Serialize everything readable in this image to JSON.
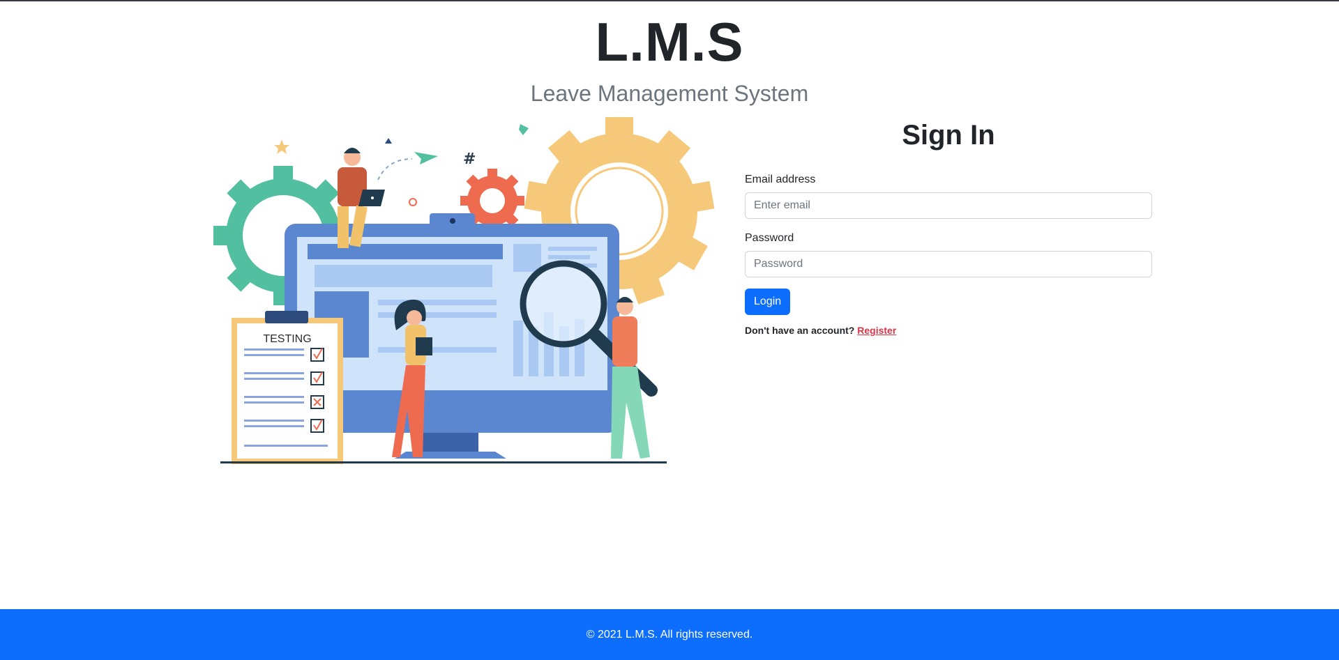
{
  "header": {
    "title": "L.M.S",
    "subtitle": "Leave Management System"
  },
  "illustration": {
    "clipboard_label": "TESTING",
    "description_icon": "testing-illustration"
  },
  "signin": {
    "heading": "Sign In",
    "email_label": "Email address",
    "email_placeholder": "Enter email",
    "email_value": "",
    "password_label": "Password",
    "password_placeholder": "Password",
    "password_value": "",
    "login_label": "Login",
    "register_prompt": "Don't have an account?",
    "register_link": "Register"
  },
  "footer": {
    "copyright": "© 2021 L.M.S. All rights reserved."
  },
  "colors": {
    "primary": "#0d6efd",
    "danger": "#dc3545",
    "muted": "#6c757d"
  }
}
